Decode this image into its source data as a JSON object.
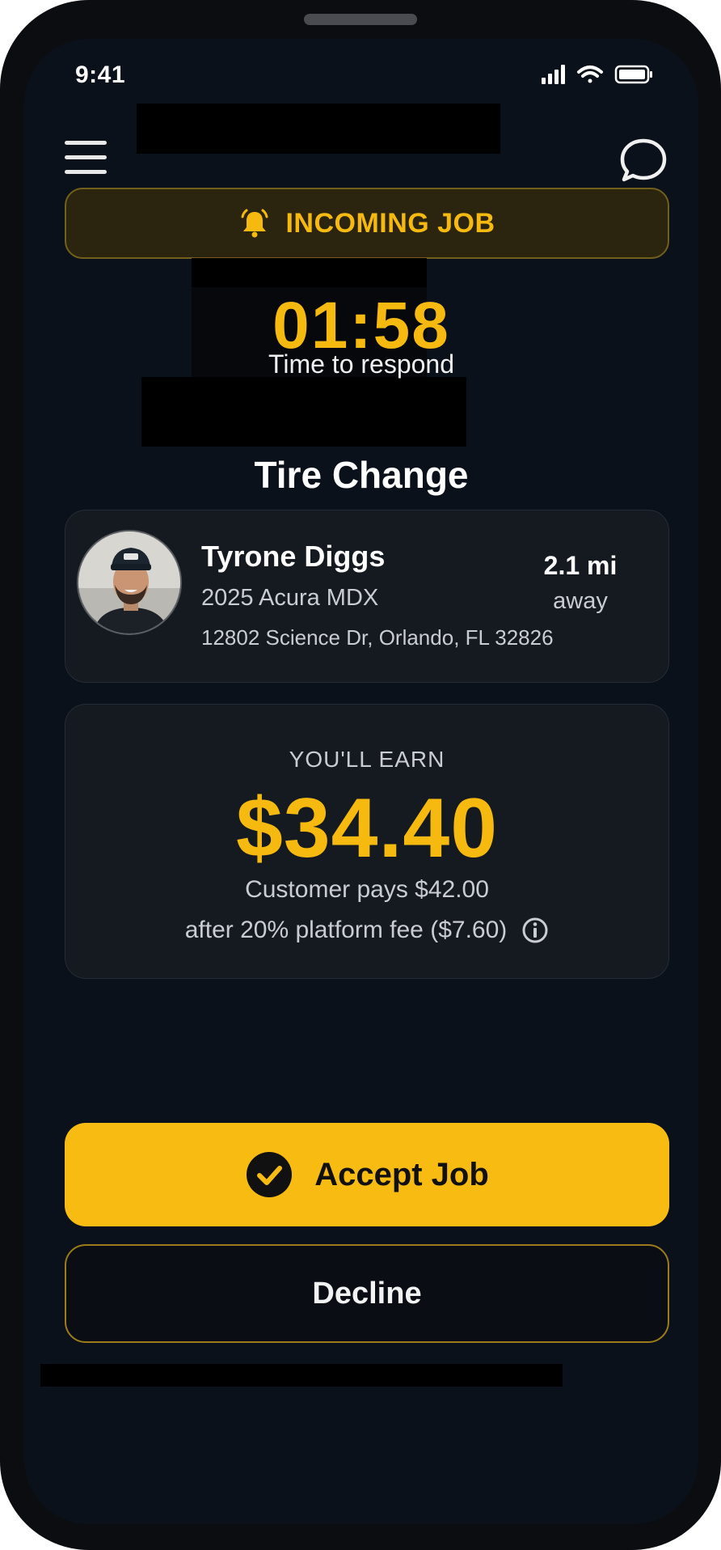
{
  "status_bar": {
    "time": "9:41"
  },
  "header": {
    "menu_icon": "hamburger-menu-icon",
    "chat_icon": "chat-bubble-icon"
  },
  "banner": {
    "icon": "bell-ringing-icon",
    "label": "INCOMING JOB"
  },
  "timer": {
    "value": "01:58",
    "label": "Time to respond"
  },
  "job": {
    "title": "Tire Change"
  },
  "customer": {
    "name": "Tyrone Diggs",
    "vehicle": "2025 Acura MDX",
    "address": "12802 Science Dr, Orlando, FL 32826",
    "distance": "2.1 mi",
    "distance_suffix": "away"
  },
  "earnings": {
    "label": "YOU'LL EARN",
    "amount": "$34.40",
    "customer_pays": "Customer pays $42.00",
    "fee_note": "after 20% platform fee ($7.60)",
    "info_icon": "info-circle-icon"
  },
  "actions": {
    "accept_label": "Accept Job",
    "decline_label": "Decline"
  },
  "colors": {
    "accent": "#f8bb12",
    "background": "#0b111a",
    "card": "#151a21",
    "banner_bg": "#2b2510",
    "decline_border": "#9c7b1b"
  }
}
